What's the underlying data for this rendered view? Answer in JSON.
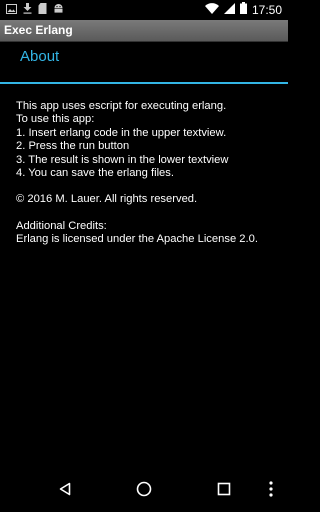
{
  "status_bar": {
    "time": "17:50",
    "left_icons": [
      "image-icon",
      "download-icon",
      "sd-card-icon",
      "android-debug-icon"
    ],
    "right_icons": [
      "wifi-icon",
      "signal-icon",
      "battery-icon"
    ]
  },
  "title_bar": {
    "title": "Exec Erlang"
  },
  "dialog": {
    "title": "About",
    "lines": [
      "This app uses escript for executing erlang.",
      "To use this app:",
      "1. Insert erlang code in the upper textview.",
      "2. Press the run button",
      "3. The result is shown in the lower textview",
      "4. You can save the erlang files.",
      "",
      "© 2016 M. Lauer. All rights reserved.",
      "",
      "Additional Credits:",
      "Erlang is licensed under the Apache License 2.0."
    ]
  },
  "nav_bar": {
    "buttons": [
      "back-icon",
      "home-icon",
      "recents-icon",
      "overflow-menu-icon"
    ]
  },
  "colors": {
    "accent": "#33b5e5",
    "background": "#000000",
    "text": "#ffffff"
  }
}
